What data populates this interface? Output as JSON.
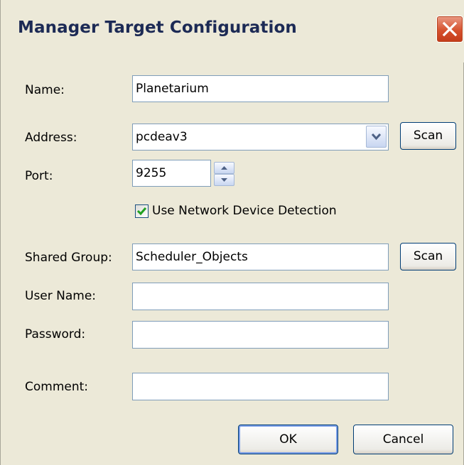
{
  "window": {
    "title": "Manager Target Configuration"
  },
  "fields": {
    "name": {
      "label": "Name:",
      "value": "Planetarium"
    },
    "address": {
      "label": "Address:",
      "value": "pcdeav3",
      "scan_label": "Scan"
    },
    "port": {
      "label": "Port:",
      "value": "9255"
    },
    "network_detection": {
      "label": "Use Network Device Detection",
      "checked": true
    },
    "shared_group": {
      "label": "Shared Group:",
      "value": "Scheduler_Objects",
      "scan_label": "Scan"
    },
    "user_name": {
      "label": "User Name:",
      "value": ""
    },
    "password": {
      "label": "Password:",
      "value": ""
    },
    "comment": {
      "label": "Comment:",
      "value": ""
    }
  },
  "buttons": {
    "ok_label": "OK",
    "cancel_label": "Cancel"
  },
  "colors": {
    "title_text": "#1c2a55",
    "dialog_background": "#ece9d8",
    "input_border": "#7f9db9",
    "check_mark": "#21a121",
    "close_button": "#d6512e"
  },
  "icons": {
    "close": "close-x-icon",
    "dropdown": "chevron-down-icon",
    "spin_up": "arrow-up-icon",
    "spin_down": "arrow-down-icon",
    "check": "checkmark-icon"
  }
}
